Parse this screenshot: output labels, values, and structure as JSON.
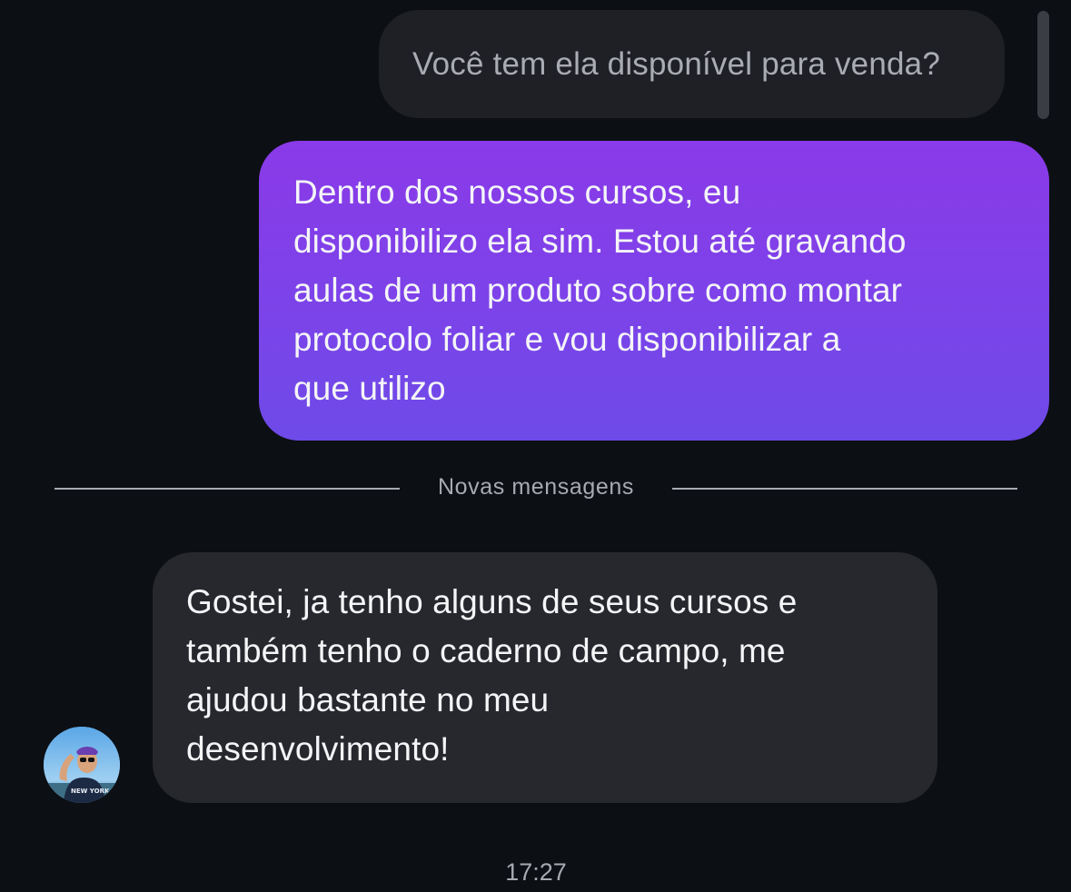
{
  "chat": {
    "quoted_message": "Você tem ela disponível para venda?",
    "outgoing_message": {
      "lines": [
        "Dentro dos nossos cursos, eu",
        "disponibilizo ela sim. Estou até gravando",
        "aulas de um produto sobre como montar",
        "protocolo foliar e vou disponibilizar a",
        "que utilizo"
      ]
    },
    "divider_label": "Novas mensagens",
    "incoming_message": {
      "lines": [
        "Gostei, ja tenho alguns de seus cursos e",
        "também tenho o caderno de campo, me",
        "ajudou bastante no meu",
        "desenvolvimento!"
      ]
    },
    "timestamp": "17:27",
    "sender_avatar_icon": "user-avatar-photo",
    "colors": {
      "background": "#0c0f14",
      "outgoing_gradient_top": "#8a3ae8",
      "outgoing_gradient_bottom": "#6e4ae8",
      "incoming_bubble": "#26282e",
      "quoted_bubble": "#1e2026"
    }
  }
}
